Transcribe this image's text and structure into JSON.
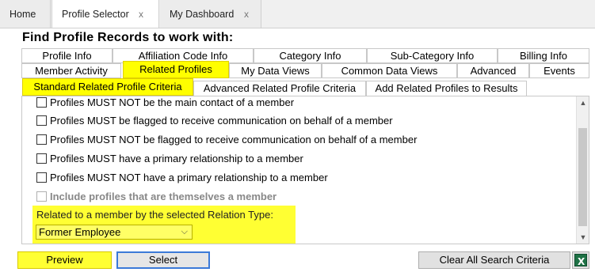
{
  "doc_tabs": [
    {
      "label": "Home"
    },
    {
      "label": "Profile Selector",
      "close": "x"
    },
    {
      "label": "My Dashboard",
      "close": "x"
    }
  ],
  "heading": "Find Profile Records to work with:",
  "criteria_tabs_row1": [
    "Profile Info",
    "Affiliation Code Info",
    "Category Info",
    "Sub-Category Info",
    "Billing Info"
  ],
  "criteria_tabs_row2": [
    "Member Activity",
    "Related Profiles",
    "My Data Views",
    "Common Data Views",
    "Advanced",
    "Events"
  ],
  "active_criteria_tab": "Related Profiles",
  "sub_tabs": [
    "Standard Related Profile Criteria",
    "Advanced Related Profile Criteria",
    "Add Related Profiles to Results"
  ],
  "active_sub_tab": "Standard Related Profile Criteria",
  "options": [
    {
      "label": "Profiles MUST NOT be the main contact of a member",
      "checked": false
    },
    {
      "label": "Profiles MUST be flagged to receive communication on behalf of a member",
      "checked": false
    },
    {
      "label": "Profiles MUST NOT be flagged to receive communication on behalf of a member",
      "checked": false
    },
    {
      "label": "Profiles MUST have a primary relationship to a member",
      "checked": false
    },
    {
      "label": "Profiles MUST NOT have a primary relationship to a member",
      "checked": false
    },
    {
      "label": "Include profiles that are themselves a member",
      "checked": false,
      "disabled": true
    }
  ],
  "relation": {
    "label": "Related to a member by the selected Relation Type:",
    "selected": "Former Employee"
  },
  "buttons": {
    "preview": "Preview",
    "select": "Select",
    "clear": "Clear All Search Criteria"
  },
  "colors": {
    "highlight": "#ffff00",
    "select_border": "#3b7ad8",
    "excel": "#1e7145"
  },
  "icons": [
    "close-icon",
    "chevron-down-icon",
    "scroll-up-icon",
    "scroll-down-icon",
    "excel-export-icon"
  ]
}
